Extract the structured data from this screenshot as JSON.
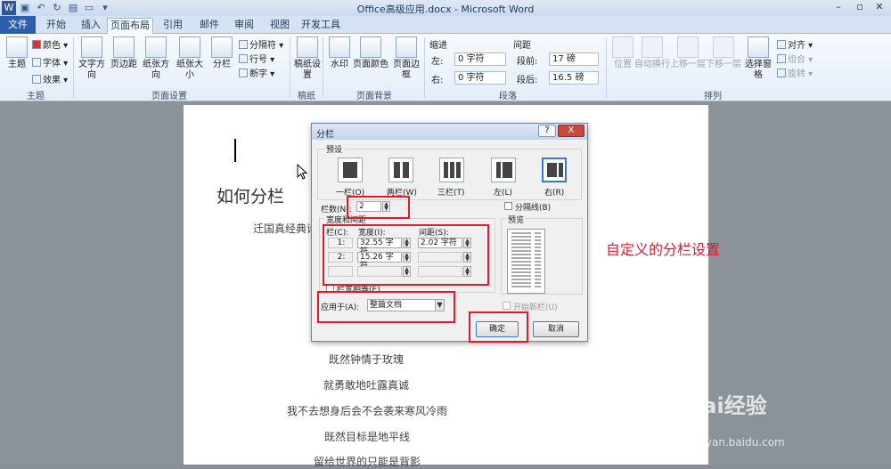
{
  "window": {
    "title": "Office高级应用.docx - Microsoft Word"
  },
  "tabs": [
    "文件",
    "开始",
    "插入",
    "页面布局",
    "引用",
    "邮件",
    "审阅",
    "视图",
    "开发工具"
  ],
  "ribbon": {
    "theme": {
      "big": "主题",
      "colors": "颜色",
      "fonts": "字体",
      "effects": "效果",
      "group": "主题"
    },
    "page_setup": {
      "text_dir": "文字方向",
      "margins": "页边距",
      "orientation": "纸张方向",
      "size": "纸张大小",
      "columns": "分栏",
      "breaks": "分隔符",
      "line_numbers": "行号",
      "hyphenation": "断字",
      "group": "页面设置"
    },
    "draft": {
      "paper": "稿纸设置",
      "group": "稿纸"
    },
    "background": {
      "watermark": "水印",
      "page_color": "页面颜色",
      "page_border": "页面边框",
      "group": "页面背景"
    },
    "paragraph": {
      "indent": "缩进",
      "spacing": "间距",
      "left_label": "左:",
      "left_val": "0 字符",
      "right_label": "右:",
      "right_val": "0 字符",
      "before_label": "段前:",
      "before_val": "17 磅",
      "after_label": "段后:",
      "after_val": "16.5 磅",
      "group": "段落"
    },
    "arrange": {
      "position": "位置",
      "wrap": "自动换行",
      "forward": "上移一层",
      "backward": "下移一层",
      "selection": "选择窗格",
      "align": "对齐",
      "group_btn": "组合",
      "rotate": "旋转",
      "group": "排列"
    }
  },
  "document": {
    "heading": "如何分栏",
    "line1": "迁国真经典诗",
    "lines": [
      "既然钟情于玫瑰",
      "就勇敢地吐露真诚",
      "我不去想身后会不会袭来寒风冷雨",
      "既然目标是地平线",
      "留给世界的只能是背影"
    ]
  },
  "dialog": {
    "title": "分栏",
    "help": "?",
    "close": "X",
    "presets_label": "预设",
    "presets": [
      "一栏(O)",
      "两栏(W)",
      "三栏(T)",
      "左(L)",
      "右(R)"
    ],
    "num_cols_label": "栏数(N):",
    "num_cols_value": "2",
    "separator_label": "分隔线(B)",
    "width_spacing_label": "宽度和间距",
    "col_header": "栏(C):",
    "width_header": "宽度(I):",
    "spacing_header": "间距(S):",
    "rows": [
      {
        "col": "1:",
        "width": "32.55 字符",
        "spacing": "2.02 字符"
      },
      {
        "col": "2:",
        "width": "15.26 字符",
        "spacing": ""
      }
    ],
    "equal_width_label": "栏宽相等(E)",
    "preview_label": "预览",
    "apply_label": "应用于(A):",
    "apply_value": "整篇文档",
    "new_col_label": "开始新栏(U)",
    "ok": "确定",
    "cancel": "取消"
  },
  "annotation": "自定义的分栏设置",
  "watermark": {
    "brand": "Bai经验",
    "url": "jingyan.baidu.com"
  }
}
